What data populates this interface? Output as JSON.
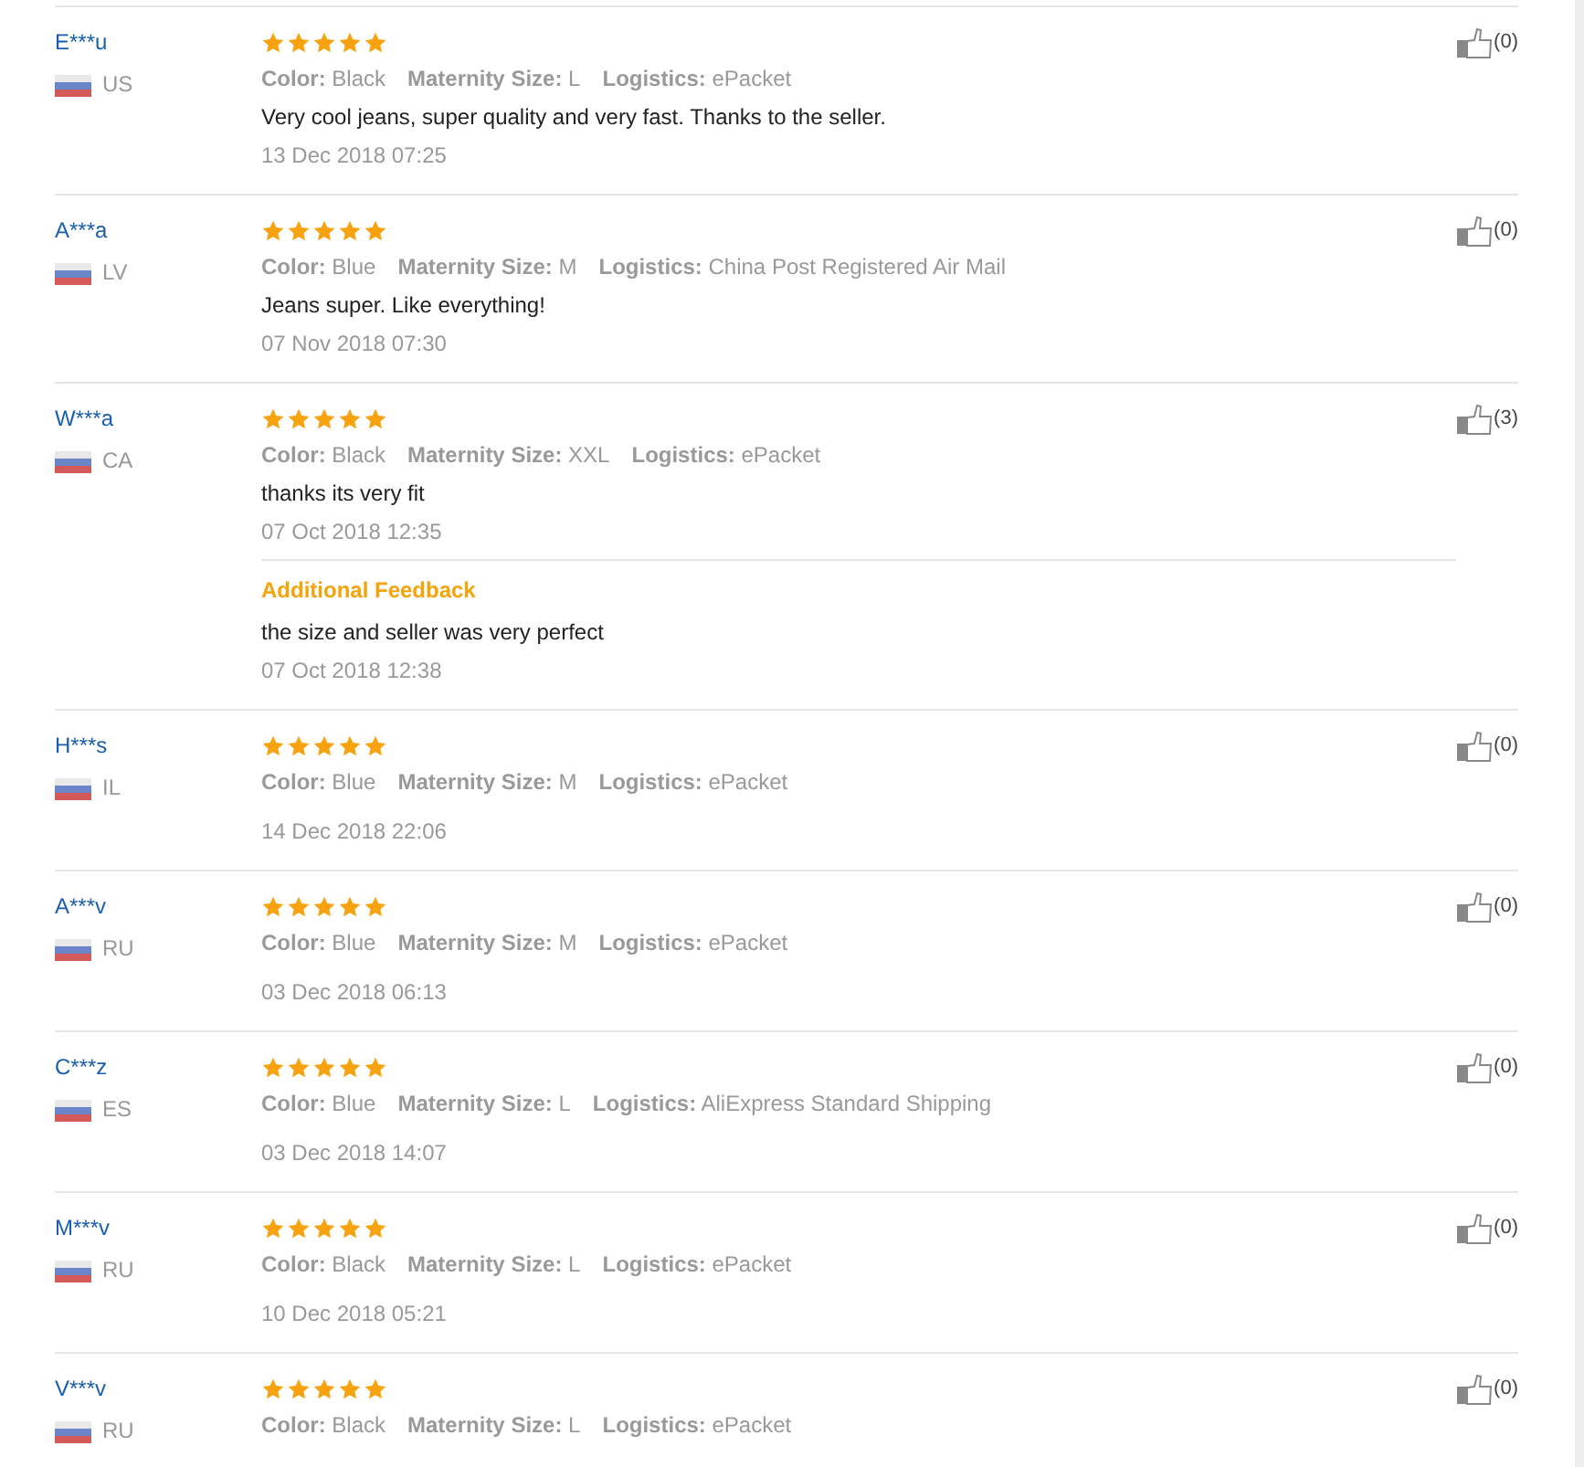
{
  "reviews": [
    {
      "buyer": "E***u",
      "country": "US",
      "stars": 5,
      "attributes": [
        {
          "label": "Color:",
          "value": "Black"
        },
        {
          "label": "Maternity Size:",
          "value": "L"
        },
        {
          "label": "Logistics:",
          "value": "ePacket"
        }
      ],
      "text": "Very cool jeans, super quality and very fast. Thanks to the seller.",
      "date": "13 Dec 2018 07:25",
      "likes": "(0)"
    },
    {
      "buyer": "A***a",
      "country": "LV",
      "stars": 5,
      "attributes": [
        {
          "label": "Color:",
          "value": "Blue"
        },
        {
          "label": "Maternity Size:",
          "value": "M"
        },
        {
          "label": "Logistics:",
          "value": "China Post Registered Air Mail"
        }
      ],
      "text": "Jeans super. Like everything!",
      "date": "07 Nov 2018 07:30",
      "likes": "(0)"
    },
    {
      "buyer": "W***a",
      "country": "CA",
      "stars": 5,
      "attributes": [
        {
          "label": "Color:",
          "value": "Black"
        },
        {
          "label": "Maternity Size:",
          "value": "XXL"
        },
        {
          "label": "Logistics:",
          "value": "ePacket"
        }
      ],
      "text": "thanks its very fit",
      "date": "07 Oct 2018 12:35",
      "likes": "(3)",
      "additional": {
        "title": "Additional Feedback",
        "text": "the size and seller was very perfect",
        "date": "07 Oct 2018 12:38"
      }
    },
    {
      "buyer": "H***s",
      "country": "IL",
      "stars": 5,
      "attributes": [
        {
          "label": "Color:",
          "value": "Blue"
        },
        {
          "label": "Maternity Size:",
          "value": "M"
        },
        {
          "label": "Logistics:",
          "value": "ePacket"
        }
      ],
      "date": "14 Dec 2018 22:06",
      "likes": "(0)"
    },
    {
      "buyer": "A***v",
      "country": "RU",
      "stars": 5,
      "attributes": [
        {
          "label": "Color:",
          "value": "Blue"
        },
        {
          "label": "Maternity Size:",
          "value": "M"
        },
        {
          "label": "Logistics:",
          "value": "ePacket"
        }
      ],
      "date": "03 Dec 2018 06:13",
      "likes": "(0)"
    },
    {
      "buyer": "C***z",
      "country": "ES",
      "stars": 5,
      "attributes": [
        {
          "label": "Color:",
          "value": "Blue"
        },
        {
          "label": "Maternity Size:",
          "value": "L"
        },
        {
          "label": "Logistics:",
          "value": "AliExpress Standard Shipping"
        }
      ],
      "date": "03 Dec 2018 14:07",
      "likes": "(0)"
    },
    {
      "buyer": "M***v",
      "country": "RU",
      "stars": 5,
      "attributes": [
        {
          "label": "Color:",
          "value": "Black"
        },
        {
          "label": "Maternity Size:",
          "value": "L"
        },
        {
          "label": "Logistics:",
          "value": "ePacket"
        }
      ],
      "date": "10 Dec 2018 05:21",
      "likes": "(0)"
    },
    {
      "buyer": "V***v",
      "country": "RU",
      "stars": 5,
      "attributes": [
        {
          "label": "Color:",
          "value": "Black"
        },
        {
          "label": "Maternity Size:",
          "value": "L"
        },
        {
          "label": "Logistics:",
          "value": "ePacket"
        }
      ],
      "likes": "(0)"
    }
  ]
}
